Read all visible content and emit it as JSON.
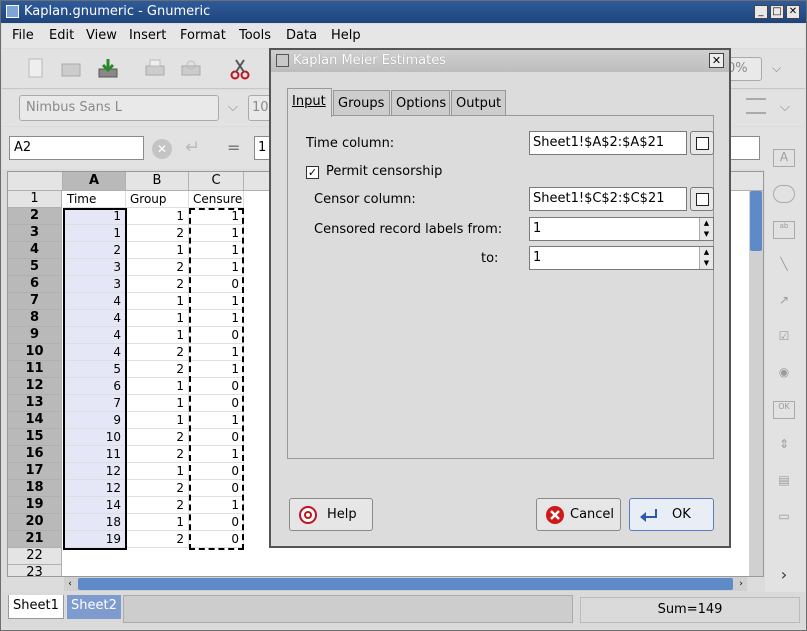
{
  "window": {
    "title": "Kaplan.gnumeric - Gnumeric"
  },
  "menu": [
    "File",
    "Edit",
    "View",
    "Insert",
    "Format",
    "Tools",
    "Data",
    "Help"
  ],
  "toolbar": {
    "zoom": "0%"
  },
  "fontbar": {
    "font": "Nimbus Sans L",
    "size": "10"
  },
  "formula": {
    "cell_ref": "A2",
    "value": "1"
  },
  "columns": [
    "A",
    "B",
    "C"
  ],
  "header_row": [
    "Time",
    "Group",
    "Censure"
  ],
  "rows": [
    {
      "n": "2",
      "a": "1",
      "b": "1",
      "c": "1"
    },
    {
      "n": "3",
      "a": "1",
      "b": "2",
      "c": "1"
    },
    {
      "n": "4",
      "a": "2",
      "b": "1",
      "c": "1"
    },
    {
      "n": "5",
      "a": "3",
      "b": "2",
      "c": "1"
    },
    {
      "n": "6",
      "a": "3",
      "b": "2",
      "c": "0"
    },
    {
      "n": "7",
      "a": "4",
      "b": "1",
      "c": "1"
    },
    {
      "n": "8",
      "a": "4",
      "b": "1",
      "c": "1"
    },
    {
      "n": "9",
      "a": "4",
      "b": "1",
      "c": "0"
    },
    {
      "n": "10",
      "a": "4",
      "b": "2",
      "c": "1"
    },
    {
      "n": "11",
      "a": "5",
      "b": "2",
      "c": "1"
    },
    {
      "n": "12",
      "a": "6",
      "b": "1",
      "c": "0"
    },
    {
      "n": "13",
      "a": "7",
      "b": "1",
      "c": "0"
    },
    {
      "n": "14",
      "a": "9",
      "b": "1",
      "c": "1"
    },
    {
      "n": "15",
      "a": "10",
      "b": "2",
      "c": "0"
    },
    {
      "n": "16",
      "a": "11",
      "b": "2",
      "c": "1"
    },
    {
      "n": "17",
      "a": "12",
      "b": "1",
      "c": "0"
    },
    {
      "n": "18",
      "a": "12",
      "b": "2",
      "c": "0"
    },
    {
      "n": "19",
      "a": "14",
      "b": "2",
      "c": "1"
    },
    {
      "n": "20",
      "a": "18",
      "b": "1",
      "c": "0"
    },
    {
      "n": "21",
      "a": "19",
      "b": "2",
      "c": "0"
    }
  ],
  "extra_rows": [
    "1",
    "22",
    "23"
  ],
  "sheet_tabs": [
    "Sheet1",
    "Sheet2"
  ],
  "status": {
    "sum": "Sum=149"
  },
  "dialog": {
    "title": "Kaplan Meier Estimates",
    "tabs": [
      "Input",
      "Groups",
      "Options",
      "Output"
    ],
    "time_label": "Time column:",
    "time_value": "Sheet1!$A$2:$A$21",
    "permit_label": "Permit censorship",
    "permit_checked": "✓",
    "censor_label": "Censor column:",
    "censor_value": "Sheet1!$C$2:$C$21",
    "labels_from_label": "Censored record labels from:",
    "labels_from_value": "1",
    "to_label": "to:",
    "to_value": "1",
    "help": "Help",
    "cancel": "Cancel",
    "ok": "OK"
  }
}
